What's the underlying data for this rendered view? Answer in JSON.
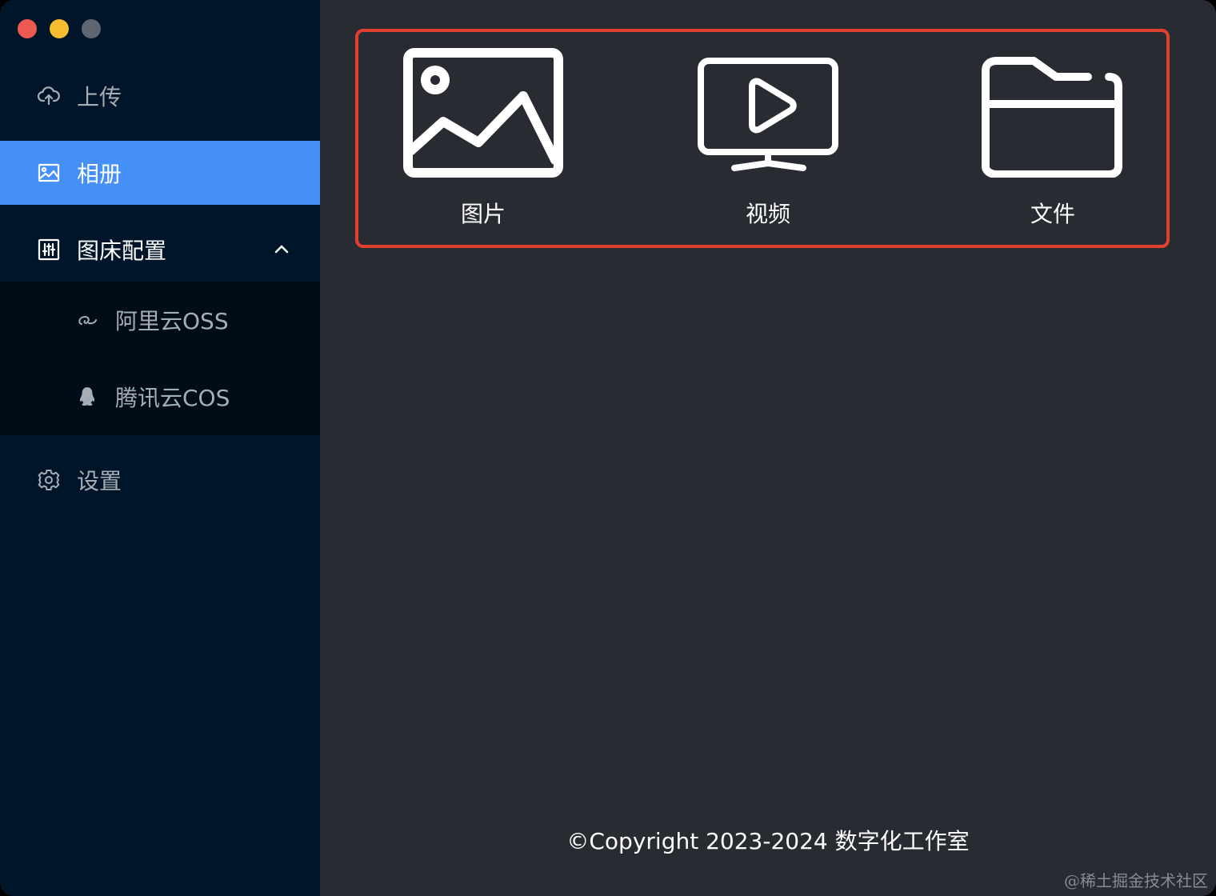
{
  "sidebar": {
    "items": [
      {
        "label": "上传",
        "icon": "cloud-upload-icon"
      },
      {
        "label": "相册",
        "icon": "picture-icon",
        "active": true
      },
      {
        "label": "图床配置",
        "icon": "control-panel-icon",
        "expanded": true,
        "children": [
          {
            "label": "阿里云OSS",
            "icon": "aliyun-icon"
          },
          {
            "label": "腾讯云COS",
            "icon": "qq-penguin-icon"
          }
        ]
      },
      {
        "label": "设置",
        "icon": "gear-icon"
      }
    ]
  },
  "main": {
    "tiles": [
      {
        "label": "图片",
        "icon": "image-icon"
      },
      {
        "label": "视频",
        "icon": "video-monitor-icon"
      },
      {
        "label": "文件",
        "icon": "folder-icon"
      }
    ],
    "copyright": "©Copyright 2023-2024 数字化工作室"
  },
  "watermark": "@稀土掘金技术社区",
  "colors": {
    "sidebar_bg": "#001529",
    "submenu_bg": "#000c17",
    "active_bg": "#4590f6",
    "main_bg": "#282b31",
    "highlight_border": "#e0402e"
  }
}
